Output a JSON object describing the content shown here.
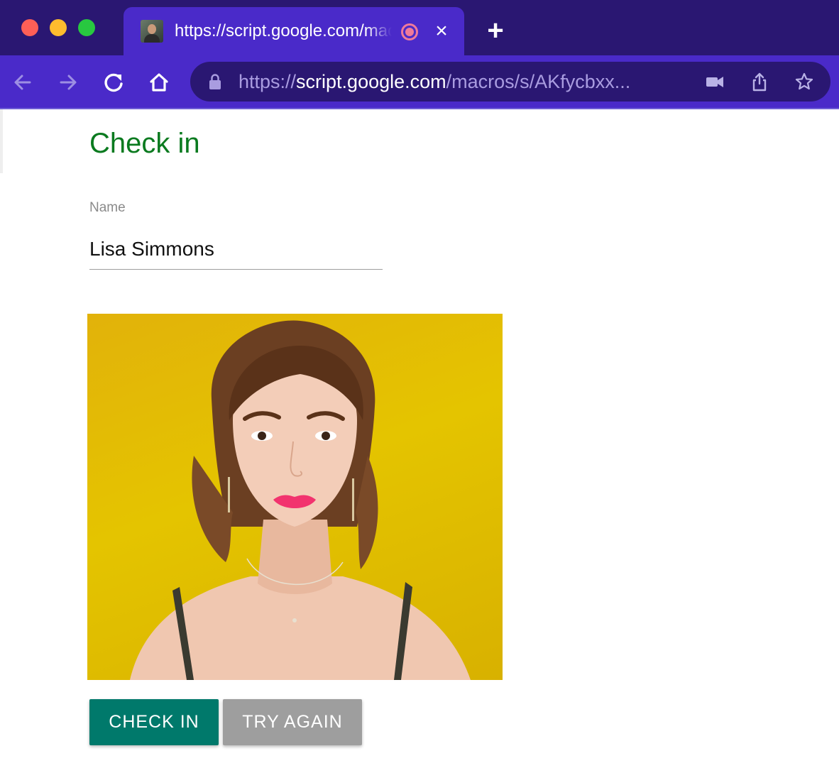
{
  "browser": {
    "tab": {
      "title": "https://script.google.com/macros/s/AKfycbxx",
      "favicon": "profile-photo-icon",
      "record_indicator": "recording-icon",
      "close": "×"
    },
    "new_tab": "+",
    "toolbar": {
      "back": "back-arrow-icon",
      "forward": "forward-arrow-icon",
      "reload": "reload-icon",
      "home": "home-icon"
    },
    "address": {
      "scheme": "https://",
      "host": "script.google.com",
      "path": "/macros/s/AKfycbxx",
      "ellipsis": "..."
    },
    "omnibox_icons": [
      "video-camera-icon",
      "share-icon",
      "star-icon"
    ],
    "colors": {
      "tabbar": "#2a1772",
      "toolbar": "#4a2ac9"
    }
  },
  "page": {
    "title": "Check in",
    "name_field": {
      "label": "Name",
      "value": "Lisa Simmons"
    },
    "photo": "captured-face-photo",
    "buttons": {
      "check_in": "CHECK IN",
      "try_again": "TRY AGAIN"
    },
    "colors": {
      "title": "#0a7a1f",
      "check_in_button": "#00796b",
      "try_again_button": "#9e9e9e"
    }
  }
}
